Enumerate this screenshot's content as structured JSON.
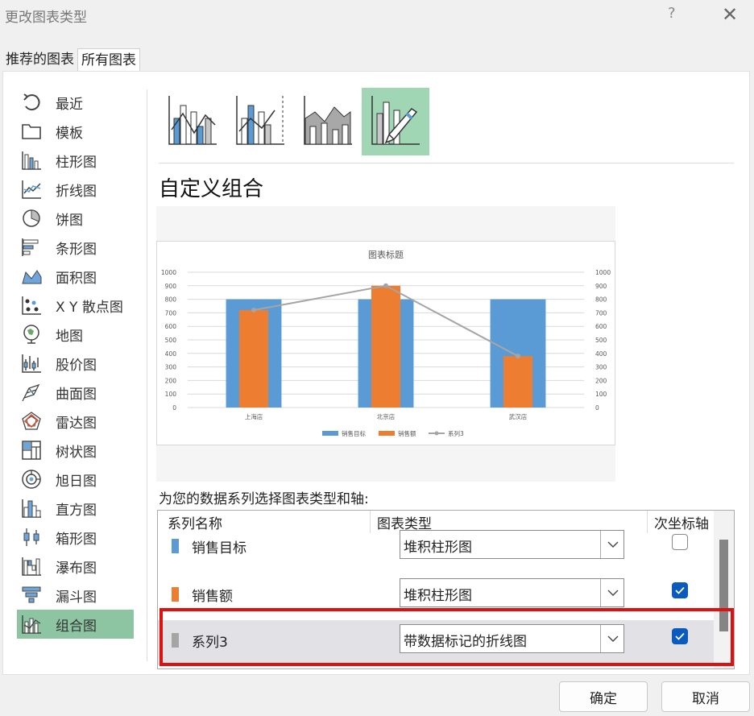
{
  "window": {
    "title": "更改图表类型",
    "help_glyph": "?",
    "close_glyph": "✕"
  },
  "tabs": [
    {
      "label": "推荐的图表",
      "active": false
    },
    {
      "label": "所有图表",
      "active": true
    }
  ],
  "chart_types": [
    {
      "label": "最近",
      "icon": "recent-icon"
    },
    {
      "label": "模板",
      "icon": "template-folder-icon"
    },
    {
      "label": "柱形图",
      "icon": "column-chart-icon"
    },
    {
      "label": "折线图",
      "icon": "line-chart-icon"
    },
    {
      "label": "饼图",
      "icon": "pie-chart-icon"
    },
    {
      "label": "条形图",
      "icon": "bar-chart-icon"
    },
    {
      "label": "面积图",
      "icon": "area-chart-icon"
    },
    {
      "label": "X Y 散点图",
      "icon": "scatter-chart-icon"
    },
    {
      "label": "地图",
      "icon": "map-chart-icon"
    },
    {
      "label": "股价图",
      "icon": "stock-chart-icon"
    },
    {
      "label": "曲面图",
      "icon": "surface-chart-icon"
    },
    {
      "label": "雷达图",
      "icon": "radar-chart-icon"
    },
    {
      "label": "树状图",
      "icon": "treemap-chart-icon"
    },
    {
      "label": "旭日图",
      "icon": "sunburst-chart-icon"
    },
    {
      "label": "直方图",
      "icon": "histogram-chart-icon"
    },
    {
      "label": "箱形图",
      "icon": "box-whisker-chart-icon"
    },
    {
      "label": "瀑布图",
      "icon": "waterfall-chart-icon"
    },
    {
      "label": "漏斗图",
      "icon": "funnel-chart-icon"
    },
    {
      "label": "组合图",
      "icon": "combo-chart-icon",
      "selected": true
    }
  ],
  "combo_variants": [
    {
      "icon": "clustered-column-line-icon",
      "selected": false
    },
    {
      "icon": "clustered-column-line-secondary-icon",
      "selected": false
    },
    {
      "icon": "stacked-area-clustered-column-icon",
      "selected": false
    },
    {
      "icon": "custom-combination-icon",
      "selected": true
    }
  ],
  "subtitle": "自定义组合",
  "chart_data": {
    "type": "bar",
    "title": "图表标题",
    "categories": [
      "上海店",
      "北京店",
      "武汉店"
    ],
    "series": [
      {
        "name": "销售目标",
        "type": "bar",
        "values": [
          800,
          800,
          800
        ],
        "color": "#5b9bd5"
      },
      {
        "name": "销售额",
        "type": "bar",
        "values": [
          720,
          900,
          380
        ],
        "color": "#ed7d31",
        "axis": "secondary"
      },
      {
        "name": "系列3",
        "type": "line",
        "values": [
          720,
          900,
          380
        ],
        "color": "#a5a5a5",
        "axis": "secondary"
      }
    ],
    "ylim": [
      0,
      1000
    ],
    "y2lim": [
      0,
      1000
    ],
    "yticks": [
      0,
      100,
      200,
      300,
      400,
      500,
      600,
      700,
      800,
      900,
      1000
    ],
    "grid": true,
    "legend": "bottom"
  },
  "series_section_title": "为您的数据系列选择图表类型和轴:",
  "grid_headers": {
    "name": "系列名称",
    "type": "图表类型",
    "secondary": "次坐标轴"
  },
  "series_rows": [
    {
      "name": "销售目标",
      "color": "#5b9bd5",
      "type": "堆积柱形图",
      "secondary": false
    },
    {
      "name": "销售额",
      "color": "#ed7d31",
      "type": "堆积柱形图",
      "secondary": true
    },
    {
      "name": "系列3",
      "color": "#a5a5a5",
      "type": "带数据标记的折线图",
      "secondary": true
    }
  ],
  "buttons": {
    "ok": "确定",
    "cancel": "取消"
  }
}
